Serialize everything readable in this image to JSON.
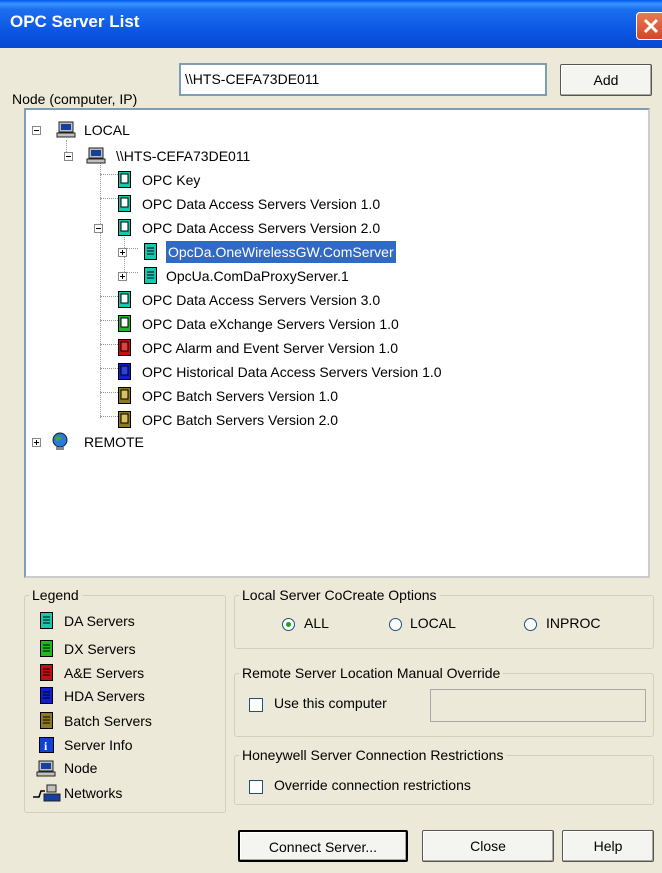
{
  "window": {
    "title": "OPC Server List",
    "close_icon": "close-icon"
  },
  "node": {
    "label": "Node (computer, IP)",
    "value": "\\\\HTS-CEFA73DE011",
    "add_label": "Add"
  },
  "tree": {
    "local": "LOCAL",
    "host": "\\\\HTS-CEFA73DE011",
    "items": [
      "OPC Key",
      "OPC Data Access Servers Version 1.0",
      "OPC Data Access Servers Version 2.0",
      "OpcDa.OneWirelessGW.ComServer",
      "OpcUa.ComDaProxyServer.1",
      "OPC Data Access Servers Version 3.0",
      "OPC Data eXchange Servers Version 1.0",
      "OPC Alarm and Event Server Version 1.0",
      "OPC Historical Data Access Servers Version 1.0",
      "OPC Batch Servers Version 1.0",
      "OPC Batch Servers Version 2.0"
    ],
    "remote": "REMOTE"
  },
  "legend": {
    "title": "Legend",
    "items": [
      "DA Servers",
      "DX Servers",
      "A&E Servers",
      "HDA Servers",
      "Batch Servers",
      "Server Info",
      "Node",
      "Networks"
    ]
  },
  "local_options": {
    "title": "Local Server CoCreate Options",
    "all": "ALL",
    "local": "LOCAL",
    "inproc": "INPROC",
    "selected": "ALL"
  },
  "remote_override": {
    "title": "Remote Server Location Manual Override",
    "use_label": "Use this computer",
    "value": ""
  },
  "restrictions": {
    "title": "Honeywell Server Connection Restrictions",
    "override_label": "Override connection restrictions"
  },
  "buttons": {
    "connect": "Connect Server...",
    "close": "Close",
    "help": "Help"
  },
  "colors": {
    "da": "#17c7b0",
    "dx": "#1fb81f",
    "ae": "#c21010",
    "hda": "#1020c8",
    "batch": "#8c7a20",
    "info": "#1040d8",
    "selection": "#316ac5"
  }
}
